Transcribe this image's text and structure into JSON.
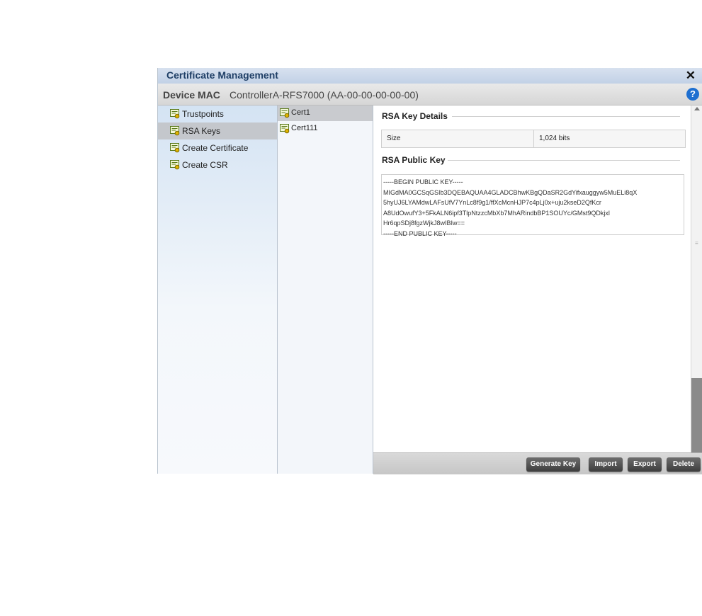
{
  "dialog": {
    "title": "Certificate Management",
    "close_glyph": "✕",
    "device_mac_label": "Device MAC",
    "device_mac_value": "ControllerA-RFS7000 (AA-00-00-00-00-00)",
    "help_glyph": "?"
  },
  "nav": {
    "items": [
      {
        "label": "Trustpoints",
        "icon": "certificate-icon"
      },
      {
        "label": "RSA Keys",
        "icon": "certificate-icon"
      },
      {
        "label": "Create Certificate",
        "icon": "certificate-icon"
      },
      {
        "label": "Create CSR",
        "icon": "certificate-icon"
      }
    ],
    "selected": "RSA Keys"
  },
  "key_list": {
    "items": [
      "Cert1",
      "Cert111"
    ],
    "selected": "Cert1"
  },
  "details": {
    "rsa_key_details_title": "RSA Key Details",
    "size_label": "Size",
    "size_value": "1,024 bits",
    "rsa_public_key_title": "RSA Public Key",
    "public_key_lines": [
      "-----BEGIN PUBLIC KEY-----",
      "MIGdMA0GCSqGSIb3DQEBAQUAA4GLADCBhwKBgQDaSR2GdYifxauggyw5MuELi8qX",
      "5hyUJ6LYAMdwLAFsUfV7YnLc8f9g1/ffXcMcnHJP7c4pLj0x+uju2kseD2QfKcr",
      "A8UdOwufY3+5FkALN6ipf3TlpNtzzcMbXb7MhARindbBP1SOUYc/GMst9QDkjxl",
      "Hr6qpSDj8fgzWjkJ8wIBIw==",
      "-----END PUBLIC KEY-----"
    ]
  },
  "footer": {
    "generate_key_label": "Generate Key",
    "import_label": "Import",
    "export_label": "Export",
    "delete_label": "Delete"
  },
  "colors": {
    "title_text": "#1f3f66",
    "help_icon": "#1e6fd0",
    "button_bg": "#4a4a4a"
  }
}
